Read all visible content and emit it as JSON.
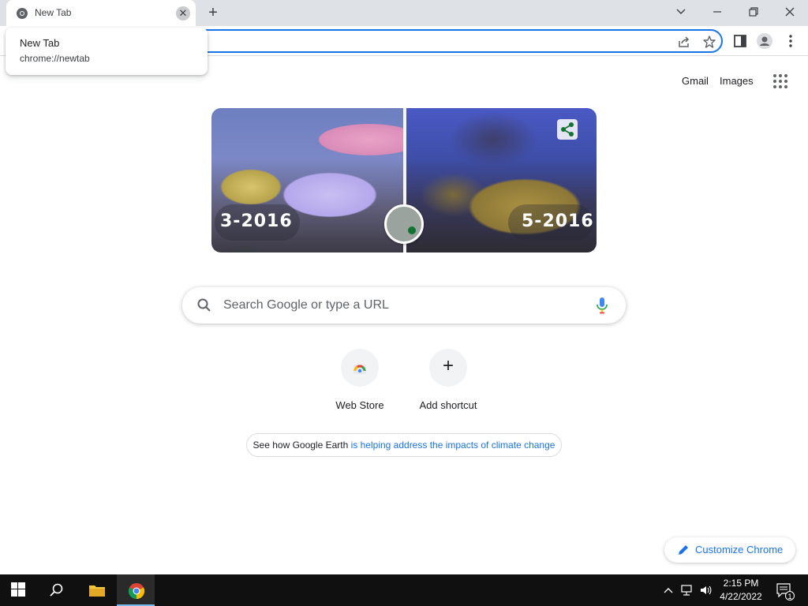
{
  "tab": {
    "title": "New Tab",
    "close_glyph": "✕"
  },
  "new_tab_glyph": "+",
  "hovercard": {
    "title": "New Tab",
    "url": "chrome://newtab"
  },
  "links": {
    "gmail": "Gmail",
    "images": "Images"
  },
  "doodle": {
    "left_label": "3-2016",
    "right_label": "5-2016"
  },
  "search": {
    "placeholder": "Search Google or type a URL"
  },
  "shortcuts": [
    {
      "label": "Web Store",
      "icon": "web-store-icon"
    },
    {
      "label": "Add shortcut",
      "icon": "plus-icon",
      "glyph": "+"
    }
  ],
  "attribution": {
    "prefix": "See how Google Earth",
    "link": " is helping address the impacts of climate change"
  },
  "customize": {
    "label": "Customize Chrome"
  },
  "taskbar": {
    "time": "2:15 PM",
    "date": "4/22/2022",
    "notification_count": "1"
  },
  "colors": {
    "accent": "#1a73e8",
    "tabstrip": "#dee1e6",
    "taskbar": "#101010"
  }
}
